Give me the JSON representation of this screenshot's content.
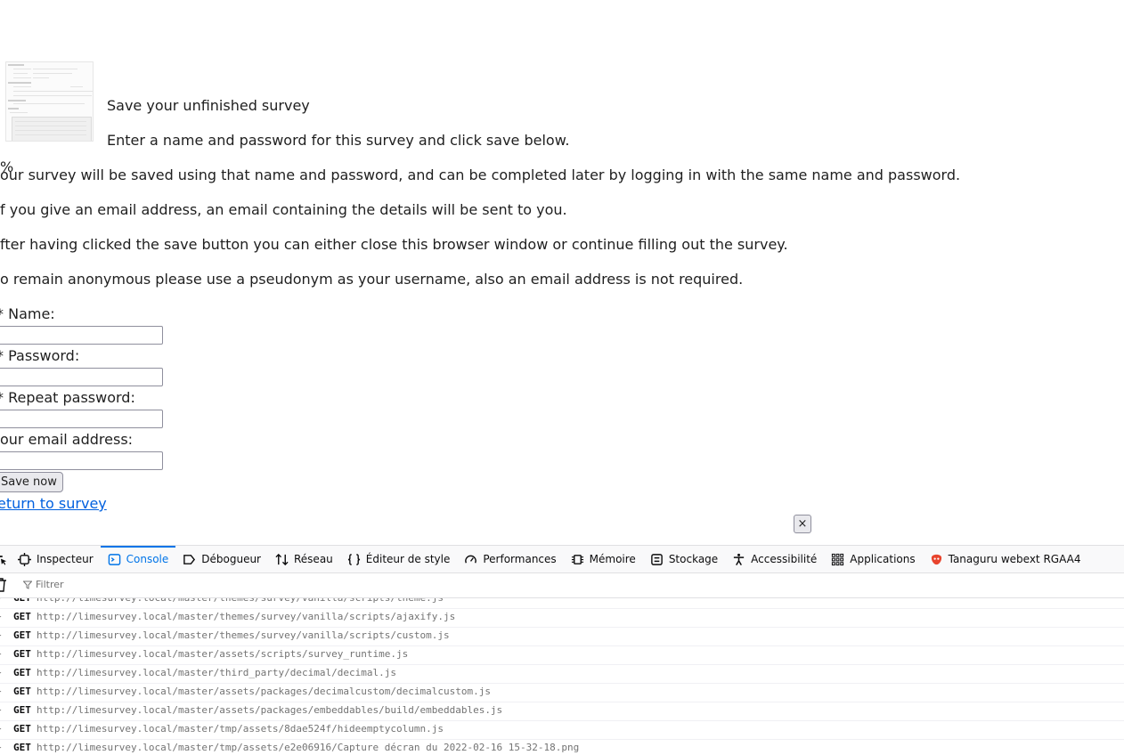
{
  "survey": {
    "thumbnail_alt": "Capture décran du 2022-02-16 15-32-18.png",
    "title": "Save your unfinished survey",
    "intro": "Enter a name and password for this survey and click save below.",
    "progress_fragment": "%",
    "paragraphs": [
      "our survey will be saved using that name and password, and can be completed later by logging in with the same name and password.",
      "f you give an email address, an email containing the details will be sent to you.",
      "fter having clicked the save button you can either close this browser window or continue filling out the survey.",
      "o remain anonymous please use a pseudonym as your username, also an email address is not required."
    ],
    "fields": {
      "name_label": "Name:",
      "password_label": "Password:",
      "repeat_label": "Repeat password:",
      "email_label": "our email address:"
    },
    "save_button": "Save now",
    "return_link": "eturn to survey",
    "close_label": "×"
  },
  "devtools": {
    "tabs": [
      {
        "label": "Inspecteur",
        "icon": "inspector-icon"
      },
      {
        "label": "Console",
        "icon": "console-icon",
        "active": true
      },
      {
        "label": "Débogueur",
        "icon": "debugger-icon"
      },
      {
        "label": "Réseau",
        "icon": "network-icon"
      },
      {
        "label": "Éditeur de style",
        "icon": "style-editor-icon"
      },
      {
        "label": "Performances",
        "icon": "performance-icon"
      },
      {
        "label": "Mémoire",
        "icon": "memory-icon"
      },
      {
        "label": "Stockage",
        "icon": "storage-icon"
      },
      {
        "label": "Accessibilité",
        "icon": "accessibility-icon"
      },
      {
        "label": "Applications",
        "icon": "applications-icon"
      },
      {
        "label": "Tanaguru webext RGAA4",
        "icon": "tanaguru-icon"
      }
    ],
    "filter_placeholder": "Filtrer",
    "accent": "#0074e8",
    "log_rows": [
      {
        "method": "GET",
        "url": "http://limesurvey.local/master/themes/survey/vanilla/scripts/theme.js"
      },
      {
        "method": "GET",
        "url": "http://limesurvey.local/master/themes/survey/vanilla/scripts/ajaxify.js"
      },
      {
        "method": "GET",
        "url": "http://limesurvey.local/master/themes/survey/vanilla/scripts/custom.js"
      },
      {
        "method": "GET",
        "url": "http://limesurvey.local/master/assets/scripts/survey_runtime.js"
      },
      {
        "method": "GET",
        "url": "http://limesurvey.local/master/third_party/decimal/decimal.js"
      },
      {
        "method": "GET",
        "url": "http://limesurvey.local/master/assets/packages/decimalcustom/decimalcustom.js"
      },
      {
        "method": "GET",
        "url": "http://limesurvey.local/master/assets/packages/embeddables/build/embeddables.js"
      },
      {
        "method": "GET",
        "url": "http://limesurvey.local/master/tmp/assets/8dae524f/hideemptycolumn.js"
      },
      {
        "method": "GET",
        "url": "http://limesurvey.local/master/tmp/assets/e2e06916/Capture décran du 2022-02-16 15-32-18.png"
      }
    ]
  }
}
